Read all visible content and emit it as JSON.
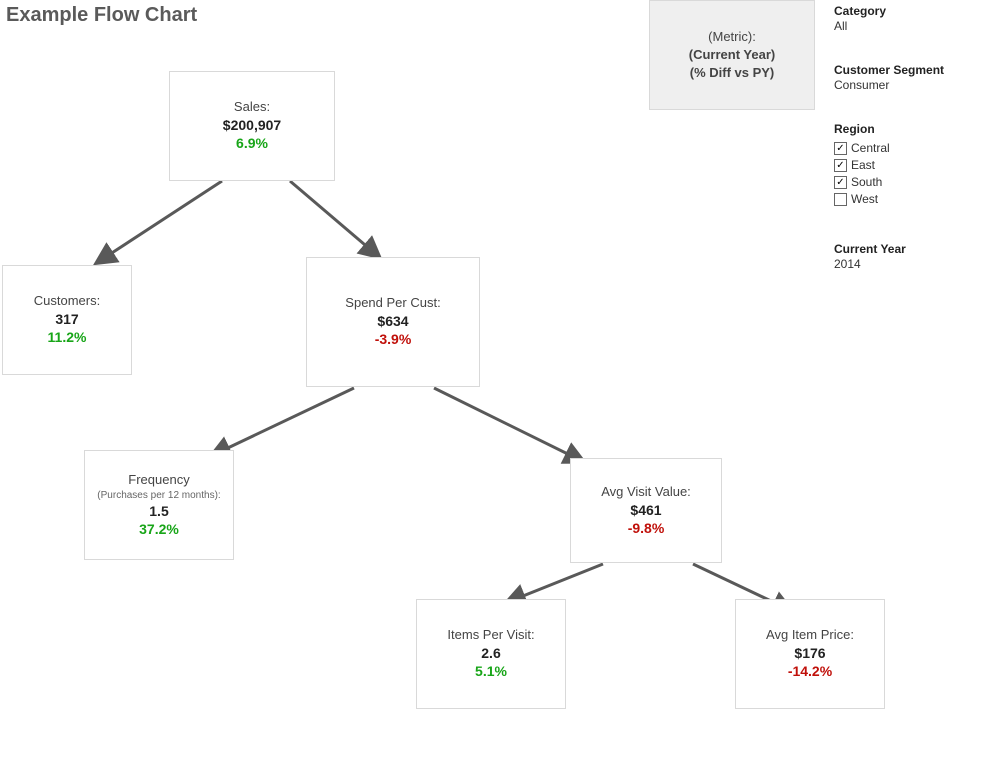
{
  "title": "Example Flow Chart",
  "legend": {
    "line1": "(Metric):",
    "line2": "(Current Year)",
    "line3": "(% Diff vs PY)"
  },
  "filters": {
    "category": {
      "label": "Category",
      "value": "All"
    },
    "segment": {
      "label": "Customer Segment",
      "value": "Consumer"
    },
    "region": {
      "label": "Region",
      "options": [
        {
          "name": "Central",
          "checked": true
        },
        {
          "name": "East",
          "checked": true
        },
        {
          "name": "South",
          "checked": true
        },
        {
          "name": "West",
          "checked": false
        }
      ]
    },
    "year": {
      "label": "Current Year",
      "value": "2014"
    }
  },
  "nodes": {
    "sales": {
      "label": "Sales:",
      "value": "$200,907",
      "delta": "6.9%",
      "delta_dir": "pos"
    },
    "customers": {
      "label": "Customers:",
      "value": "317",
      "delta": "11.2%",
      "delta_dir": "pos"
    },
    "spend": {
      "label": "Spend Per Cust:",
      "value": "$634",
      "delta": "-3.9%",
      "delta_dir": "neg"
    },
    "frequency": {
      "label": "Frequency",
      "sublabel": "(Purchases per 12 months):",
      "value": "1.5",
      "delta": "37.2%",
      "delta_dir": "pos"
    },
    "avgvisit": {
      "label": "Avg Visit Value:",
      "value": "$461",
      "delta": "-9.8%",
      "delta_dir": "neg"
    },
    "items": {
      "label": "Items Per Visit:",
      "value": "2.6",
      "delta": "5.1%",
      "delta_dir": "pos"
    },
    "avgprice": {
      "label": "Avg Item Price:",
      "value": "$176",
      "delta": "-14.2%",
      "delta_dir": "neg"
    }
  }
}
